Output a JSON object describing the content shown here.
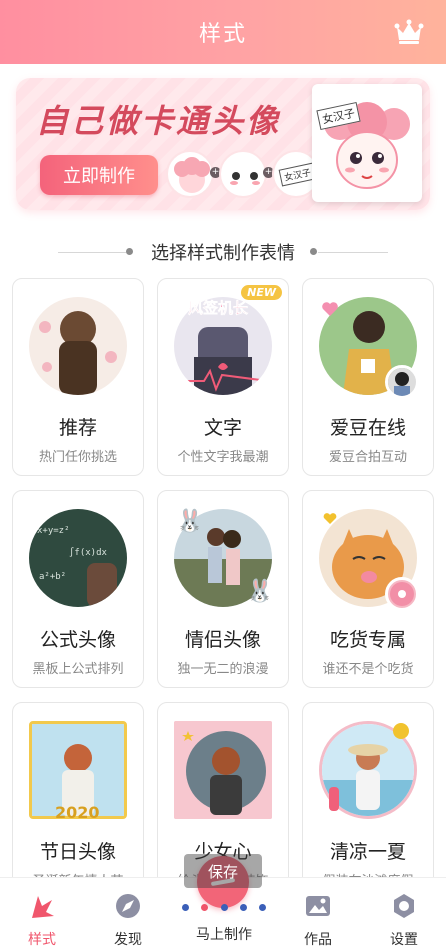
{
  "header": {
    "title": "样式",
    "crown_icon": "crown-icon"
  },
  "banner": {
    "title": "自己做卡通头像",
    "button_label": "立即制作",
    "sign_text": "女汉子",
    "mini_sign_text": "女汉子",
    "ops": [
      "+",
      "+",
      "="
    ]
  },
  "section": {
    "title": "选择样式制作表情"
  },
  "cards": [
    {
      "title": "推荐",
      "subtitle": "热门任你挑选"
    },
    {
      "title": "文字",
      "subtitle": "个性文字我最潮",
      "badge": "NEW",
      "overlay_text": "风签机长"
    },
    {
      "title": "爱豆在线",
      "subtitle": "爱豆合拍互动"
    },
    {
      "title": "公式头像",
      "subtitle": "黑板上公式排列"
    },
    {
      "title": "情侣头像",
      "subtitle": "独一无二的浪漫"
    },
    {
      "title": "吃货专属",
      "subtitle": "谁还不是个吃货"
    },
    {
      "title": "节日头像",
      "subtitle": "圣诞新年情人节",
      "overlay_text": "2020"
    },
    {
      "title": "少女心",
      "subtitle": "给头像添点装饰"
    },
    {
      "title": "清凉一夏",
      "subtitle": "假装在沙滩度假"
    }
  ],
  "tooltip": "保存",
  "tabs": [
    {
      "label": "样式",
      "icon": "style-icon",
      "active": true
    },
    {
      "label": "发现",
      "icon": "discover-icon",
      "active": false
    },
    {
      "label": "马上制作",
      "icon": "make-icon",
      "active": false
    },
    {
      "label": "作品",
      "icon": "works-icon",
      "active": false
    },
    {
      "label": "设置",
      "icon": "settings-icon",
      "active": false
    }
  ],
  "colors": {
    "accent": "#f0566c",
    "header_start": "#ff8fa0",
    "header_end": "#ffb39c"
  }
}
